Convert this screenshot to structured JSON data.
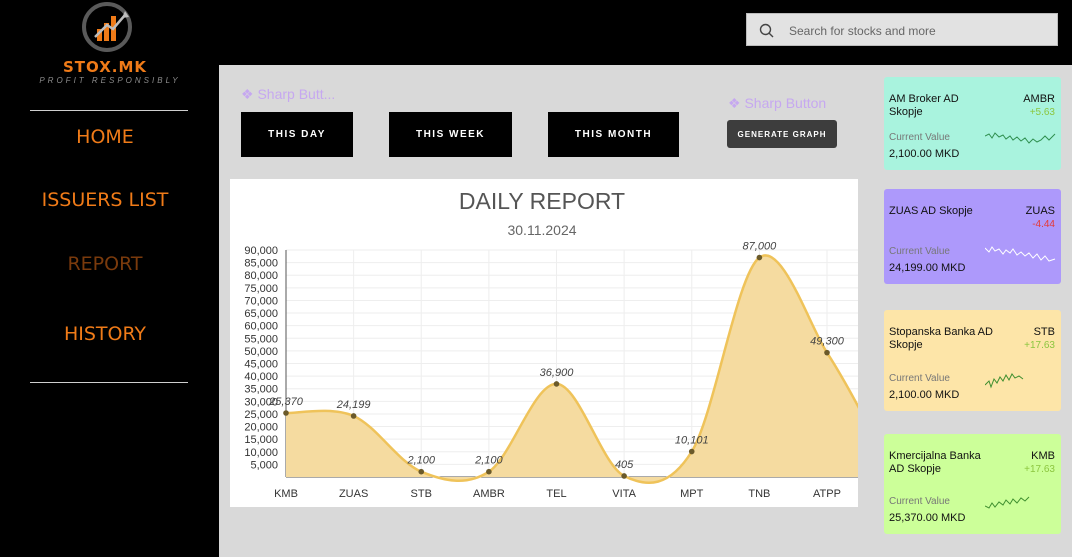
{
  "brand": {
    "name": "STOX.MK",
    "tagline": "PROFIT RESPONSIBLY"
  },
  "nav": [
    {
      "label": "HOME"
    },
    {
      "label": "ISSUERS LIST"
    },
    {
      "label": "REPORT"
    },
    {
      "label": "HISTORY"
    }
  ],
  "search": {
    "placeholder": "Search for stocks and more"
  },
  "ghost_buttons": [
    "❖ Sharp Butt...",
    "❖ Sharp Button"
  ],
  "period_buttons": [
    "THIS DAY",
    "THIS WEEK",
    "THIS MONTH"
  ],
  "generate_button": "GENERATE GRAPH",
  "chart_data": {
    "type": "area",
    "title": "DAILY REPORT",
    "subtitle": "30.11.2024",
    "categories": [
      "KMB",
      "ZUAS",
      "STB",
      "AMBR",
      "TEL",
      "VITA",
      "MPT",
      "TNB",
      "ATPP"
    ],
    "values": [
      25370,
      24199,
      2100,
      2100,
      36900,
      405,
      10101,
      87000,
      49300
    ],
    "value_labels": [
      "25,370",
      "24,199",
      "2,100",
      "2,100",
      "36,900",
      "405",
      "10,101",
      "87,000",
      "49,300"
    ],
    "yticks": [
      "90,000",
      "85,000",
      "80,000",
      "75,000",
      "70,000",
      "65,000",
      "60,000",
      "55,000",
      "50,000",
      "45,000",
      "40,000",
      "35,000",
      "30,000",
      "25,000",
      "20,000",
      "15,000",
      "10,000",
      "5,000"
    ],
    "ylim": [
      0,
      90000
    ],
    "grid": true,
    "colors": {
      "fill": "#f5dba0",
      "line": "#efc35a",
      "point": "#6b5a2a"
    }
  },
  "cards": [
    {
      "name": "AM Broker AD Skopje",
      "ticker": "AMBR",
      "change": "+5.63",
      "value_label": "Current Value",
      "value": "2,100.00 MKD",
      "bg": "#a9f3de",
      "change_color": "#8cc63f",
      "spark_color": "#2f8f4f"
    },
    {
      "name": "ZUAS AD Skopje",
      "ticker": "ZUAS",
      "change": "-4.44",
      "value_label": "Current Value",
      "value": "24,199.00 MKD",
      "bg": "#ad99fb",
      "change_color": "#e53935",
      "spark_color": "#ffffff"
    },
    {
      "name": "Stopanska Banka AD Skopje",
      "ticker": "STB",
      "change": "+17.63",
      "value_label": "Current Value",
      "value": "2,100.00 MKD",
      "bg": "#fde5a8",
      "change_color": "#8cc63f",
      "spark_color": "#3f8f2f"
    },
    {
      "name": "Kmercijalna Banka AD Skopje",
      "ticker": "KMB",
      "change": "+17.63",
      "value_label": "Current Value",
      "value": "25,370.00 MKD",
      "bg": "#ccff99",
      "change_color": "#8cc63f",
      "spark_color": "#3f8f2f"
    }
  ]
}
